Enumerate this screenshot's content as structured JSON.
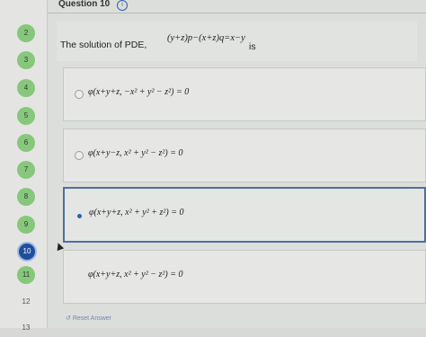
{
  "sidebar": {
    "numbers": [
      {
        "num": "2",
        "state": "done"
      },
      {
        "num": "3",
        "state": "done"
      },
      {
        "num": "4",
        "state": "done"
      },
      {
        "num": "5",
        "state": "done"
      },
      {
        "num": "6",
        "state": "done"
      },
      {
        "num": "7",
        "state": "done"
      },
      {
        "num": "8",
        "state": "done"
      },
      {
        "num": "9",
        "state": "done"
      },
      {
        "num": "10",
        "state": "current"
      },
      {
        "num": "11",
        "state": "done"
      },
      {
        "num": "12",
        "state": "plain"
      },
      {
        "num": "13",
        "state": "plain"
      }
    ]
  },
  "header": {
    "question_title": "Question 10",
    "info_icon": "info-icon"
  },
  "question": {
    "prefix": "The solution of PDE,",
    "equation": "(y+z)p−(x+z)q=x−y",
    "suffix": "is"
  },
  "options": [
    {
      "text": "φ(x+y+z, −x² + y² − z²) = 0",
      "selected": false
    },
    {
      "text": "φ(x+y−z, x² + y² − z²) = 0",
      "selected": false
    },
    {
      "text": "φ(x+y+z, x² + y² + z²) = 0",
      "selected": true
    },
    {
      "text": "φ(x+y+z, x² + y² − z²) = 0",
      "selected": false
    }
  ],
  "reset_label": "Reset Answer",
  "colors": {
    "done": "#86c77c",
    "current": "#1f4e9c",
    "accent": "#2f5fb3"
  }
}
